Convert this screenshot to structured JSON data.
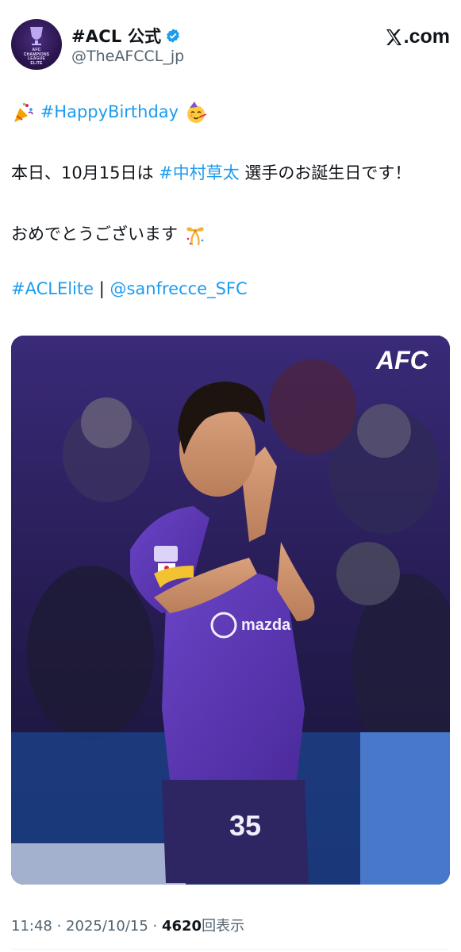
{
  "post": {
    "display_name": "#ACL 公式",
    "handle": "@TheAFCCL_jp",
    "avatar_text": [
      "AFC",
      "CHAMPIONS",
      "LEAGUE",
      "ELITE"
    ],
    "site_logo": ".com",
    "verified": true,
    "lines": {
      "line1_tag": "#HappyBirthday",
      "line2_pre": "本日、10月15日は ",
      "line2_tag": "#中村草太",
      "line2_post": " 選手のお誕生日です！",
      "line3": "おめでとうございます",
      "line4_tag1": "#ACLElite",
      "line4_sep": " | ",
      "line4_tag2": "@sanfrecce_SFC"
    },
    "image": {
      "watermark": "AFC",
      "jersey_sponsor": "mazda",
      "jersey_number": "35"
    },
    "meta": {
      "time": "11:48",
      "sep1": " · ",
      "date": "2025/10/15",
      "sep2": " · ",
      "views": "4620",
      "views_label": "回表示"
    },
    "colors": {
      "link": "#1d9bf0",
      "secondary_text": "#536471",
      "verified_badge": "#1d9bf0",
      "kit_purple": "#5b35b5"
    },
    "icons": [
      "party-popper-icon",
      "partying-face-icon",
      "verified-badge-icon",
      "x-logo-icon",
      "gift-ribbon-icon"
    ]
  }
}
